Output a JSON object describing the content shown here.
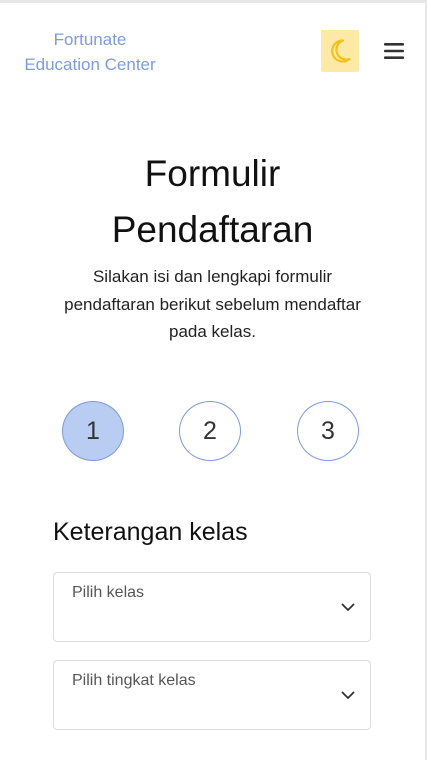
{
  "header": {
    "brand_line1": "Fortunate",
    "brand_line2": "Education Center",
    "theme_icon": "moon-icon",
    "menu_icon": "hamburger-menu-icon"
  },
  "main": {
    "title_line1": "Formulir",
    "title_line2": "Pendaftaran",
    "subtitle": "Silakan isi dan lengkapi formulir pendaftaran berikut sebelum mendaftar pada kelas.",
    "steps": [
      {
        "label": "1",
        "active": true
      },
      {
        "label": "2",
        "active": false
      },
      {
        "label": "3",
        "active": false
      }
    ],
    "section_title": "Keterangan kelas",
    "selects": [
      {
        "label": "Pilih kelas"
      },
      {
        "label": "Pilih tingkat kelas"
      }
    ]
  },
  "colors": {
    "brand": "#7c9be0",
    "theme_toggle_bg": "#fde9a6",
    "moon": "#f2c21a",
    "step_active_bg": "#b9ccf1",
    "step_border": "#7c9be0"
  }
}
